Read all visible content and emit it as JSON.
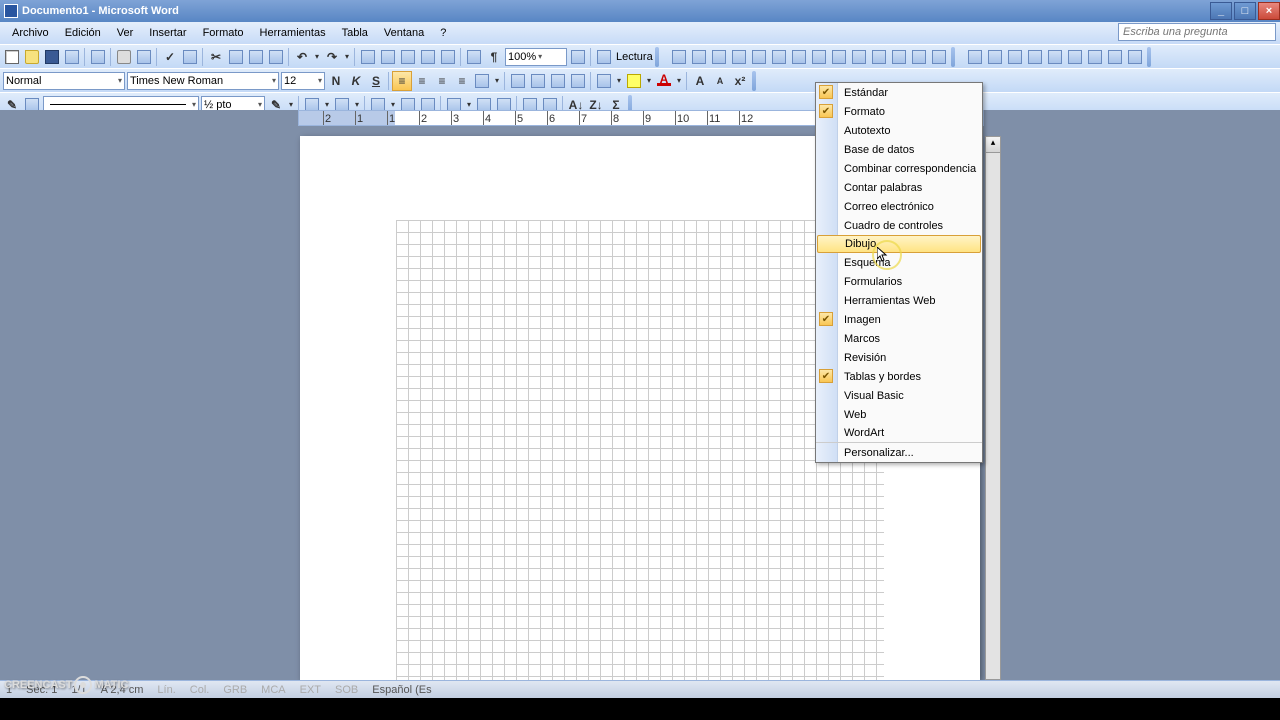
{
  "title": "Documento1 - Microsoft Word",
  "askbox_placeholder": "Escriba una pregunta",
  "menus": [
    "Archivo",
    "Edición",
    "Ver",
    "Insertar",
    "Formato",
    "Herramientas",
    "Tabla",
    "Ventana",
    "?"
  ],
  "style_combo": "Normal",
  "font_combo": "Times New Roman",
  "size_combo": "12",
  "zoom_combo": "100%",
  "read_label": "Lectura",
  "line_weight_combo": "½ pto",
  "bold_glyph": "N",
  "italic_glyph": "K",
  "underline_glyph": "S",
  "ruler_numbers": [
    "2",
    "1",
    "1",
    "2",
    "3",
    "4",
    "5",
    "6",
    "7",
    "8",
    "9",
    "10",
    "11",
    "12"
  ],
  "toolbars_menu": [
    {
      "label": "Estándar",
      "checked": true
    },
    {
      "label": "Formato",
      "checked": true
    },
    {
      "label": "Autotexto",
      "checked": false
    },
    {
      "label": "Base de datos",
      "checked": false
    },
    {
      "label": "Combinar correspondencia",
      "checked": false
    },
    {
      "label": "Contar palabras",
      "checked": false
    },
    {
      "label": "Correo electrónico",
      "checked": false
    },
    {
      "label": "Cuadro de controles",
      "checked": false
    },
    {
      "label": "Dibujo",
      "checked": false,
      "highlight": true
    },
    {
      "label": "Esquema",
      "checked": false
    },
    {
      "label": "Formularios",
      "checked": false
    },
    {
      "label": "Herramientas Web",
      "checked": false
    },
    {
      "label": "Imagen",
      "checked": true
    },
    {
      "label": "Marcos",
      "checked": false
    },
    {
      "label": "Revisión",
      "checked": false
    },
    {
      "label": "Tablas y bordes",
      "checked": true
    },
    {
      "label": "Visual Basic",
      "checked": false
    },
    {
      "label": "Web",
      "checked": false
    },
    {
      "label": "WordArt",
      "checked": false,
      "sep_after": true
    },
    {
      "label": "Personalizar...",
      "checked": false
    }
  ],
  "status": {
    "page": "1",
    "sec": "Sec. 1",
    "pages": "1/1",
    "at": "A 2,4 cm",
    "ln": "Lín.",
    "col": "Col.",
    "flags": [
      "GRB",
      "MCA",
      "EXT",
      "SOB"
    ],
    "lang": "Español (Es"
  },
  "watermark": {
    "left": "CREENCAST",
    "right": "MATIC"
  }
}
